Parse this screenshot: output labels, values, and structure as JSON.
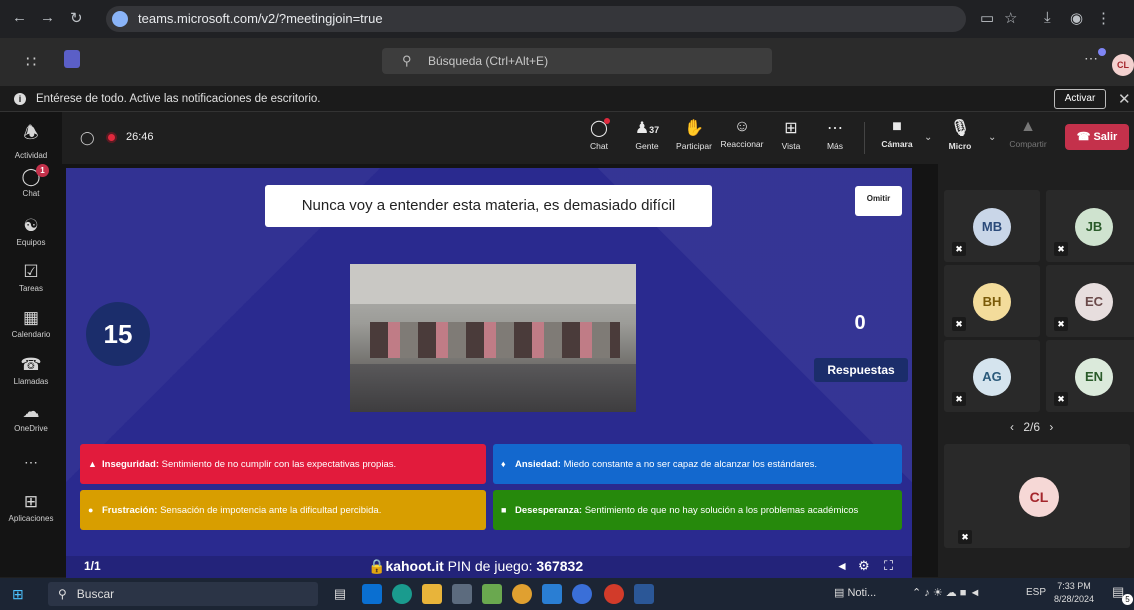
{
  "browser": {
    "url": "teams.microsoft.com/v2/?meetingjoin=true"
  },
  "teams_header": {
    "search_placeholder": "Búsqueda (Ctrl+Alt+E)",
    "user_initials": "CL"
  },
  "notification": {
    "text": "Entérese de todo. Active las notificaciones de escritorio.",
    "activate_label": "Activar"
  },
  "rail": {
    "activity": "Actividad",
    "chat": "Chat",
    "chat_badge": "1",
    "teams": "Equipos",
    "tasks": "Tareas",
    "calendar": "Calendario",
    "calls": "Llamadas",
    "onedrive": "OneDrive",
    "apps": "Aplicaciones"
  },
  "meeting": {
    "elapsed": "26:46",
    "toolbar": {
      "chat": "Chat",
      "people_count": "37",
      "people": "Gente",
      "raise": "Participar",
      "react": "Reaccionar",
      "view": "Vista",
      "more": "Más",
      "camera": "Cámara",
      "mic": "Micro",
      "share": "Compartir",
      "leave": "Salir"
    }
  },
  "kahoot": {
    "question": "Nunca voy a entender esta materia, es demasiado difícil",
    "skip": "Omitir",
    "timer": "15",
    "answers_count": "0",
    "answers_label": "Respuestas",
    "answers": [
      {
        "label": "Inseguridad:",
        "text": "Sentimiento de no cumplir con las expectativas propias.",
        "color": "#e21b3c"
      },
      {
        "label": "Ansiedad:",
        "text": "Miedo constante a no ser capaz de alcanzar los estándares.",
        "color": "#1368ce"
      },
      {
        "label": "Frustración:",
        "text": "Sensación de impotencia ante la dificultad percibida.",
        "color": "#d89e00"
      },
      {
        "label": "Desesperanza:",
        "text": "Sentimiento de que no hay solución a los problemas académicos",
        "color": "#26890c"
      }
    ],
    "counter": "1/1",
    "site": "kahoot.it",
    "pin_label": "PIN de juego:",
    "pin": "367832"
  },
  "participants": {
    "tiles": [
      {
        "initials": "MB",
        "color": "#c9d6e8"
      },
      {
        "initials": "JB",
        "color": "#cfe3cf"
      },
      {
        "initials": "BH",
        "color": "#f3dc9b"
      },
      {
        "initials": "EC",
        "color": "#e7dede"
      },
      {
        "initials": "AG",
        "color": "#d5e4ee"
      },
      {
        "initials": "EN",
        "color": "#dbeadb"
      }
    ],
    "pager": "2/6",
    "self_initials": "CL",
    "self_color": "#f6d8d6"
  },
  "taskbar": {
    "search": "Buscar",
    "news": "Noti...",
    "lang": "ESP",
    "time": "7:33 PM",
    "date": "8/28/2024",
    "notif_count": "5"
  }
}
